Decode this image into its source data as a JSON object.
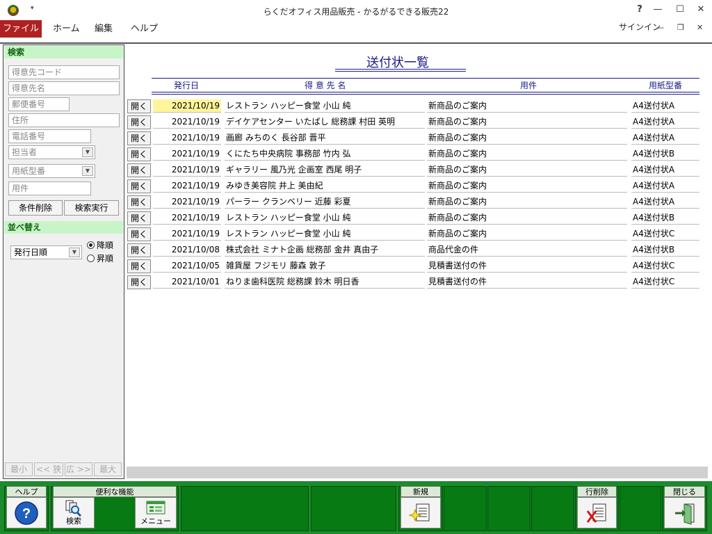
{
  "window": {
    "title": "らくだオフィス用品販売 - かるがるできる販売22",
    "help_icon": "?",
    "minimize_icon": "—",
    "maximize_icon": "☐",
    "close_icon": "✕"
  },
  "menu": {
    "file": "ファイル",
    "home": "ホーム",
    "edit": "編集",
    "help": "ヘルプ",
    "signin": "サインイン",
    "sub_minimize": "—",
    "sub_restore": "❐",
    "sub_close": "✕"
  },
  "search": {
    "header": "検索",
    "customer_code_placeholder": "得意先コード",
    "customer_name_placeholder": "得意先名",
    "postal_placeholder": "郵便番号",
    "address_placeholder": "住所",
    "phone_placeholder": "電話番号",
    "staff_placeholder": "担当者",
    "paper_type_placeholder": "用紙型番",
    "subject_placeholder": "用件",
    "clear_button": "条件削除",
    "execute_button": "検索実行"
  },
  "sort": {
    "header": "並べ替え",
    "field_value": "発行日順",
    "desc_label": "降順",
    "asc_label": "昇順"
  },
  "zoom": {
    "min": "最小",
    "narrow": "<< 狭",
    "wide": "広 >>",
    "max": "最大"
  },
  "list": {
    "title": "送付状一覧",
    "columns": {
      "date": "発行日",
      "customer": "得 意 先 名",
      "subject": "用件",
      "paper": "用紙型番"
    },
    "open_label": "開く",
    "rows": [
      {
        "date": "2021/10/19",
        "customer": "レストラン ハッピー食堂 小山 純",
        "subject": "新商品のご案内",
        "paper": "A4送付状A"
      },
      {
        "date": "2021/10/19",
        "customer": "デイケアセンター いたばし 総務課 村田 英明",
        "subject": "新商品のご案内",
        "paper": "A4送付状A"
      },
      {
        "date": "2021/10/19",
        "customer": "画廊 みちのく 長谷部 晋平",
        "subject": "新商品のご案内",
        "paper": "A4送付状A"
      },
      {
        "date": "2021/10/19",
        "customer": "くにたち中央病院 事務部 竹内 弘",
        "subject": "新商品のご案内",
        "paper": "A4送付状B"
      },
      {
        "date": "2021/10/19",
        "customer": "ギャラリー 風乃光 企画室 西尾 明子",
        "subject": "新商品のご案内",
        "paper": "A4送付状A"
      },
      {
        "date": "2021/10/19",
        "customer": "みゆき美容院 井上 美由紀",
        "subject": "新商品のご案内",
        "paper": "A4送付状A"
      },
      {
        "date": "2021/10/19",
        "customer": "パーラー クランベリー 近藤 彩夏",
        "subject": "新商品のご案内",
        "paper": "A4送付状A"
      },
      {
        "date": "2021/10/19",
        "customer": "レストラン ハッピー食堂 小山 純",
        "subject": "新商品のご案内",
        "paper": "A4送付状B"
      },
      {
        "date": "2021/10/19",
        "customer": "レストラン ハッピー食堂 小山 純",
        "subject": "新商品のご案内",
        "paper": "A4送付状C"
      },
      {
        "date": "2021/10/08",
        "customer": "株式会社 ミナト企画 総務部 金井 真由子",
        "subject": "商品代金の件",
        "paper": "A4送付状B"
      },
      {
        "date": "2021/10/05",
        "customer": "雑貨屋 フジモリ 藤森 敦子",
        "subject": "見積書送付の件",
        "paper": "A4送付状C"
      },
      {
        "date": "2021/10/01",
        "customer": "ねりま歯科医院 総務課 鈴木 明日香",
        "subject": "見積書送付の件",
        "paper": "A4送付状C"
      }
    ]
  },
  "toolbar": {
    "help_label": "ヘルプ",
    "tools_label": "便利な機能",
    "search_label": "検索",
    "menu_label": "メニュー",
    "new_label": "新規",
    "delete_row_label": "行削除",
    "close_label": "閉じる"
  }
}
